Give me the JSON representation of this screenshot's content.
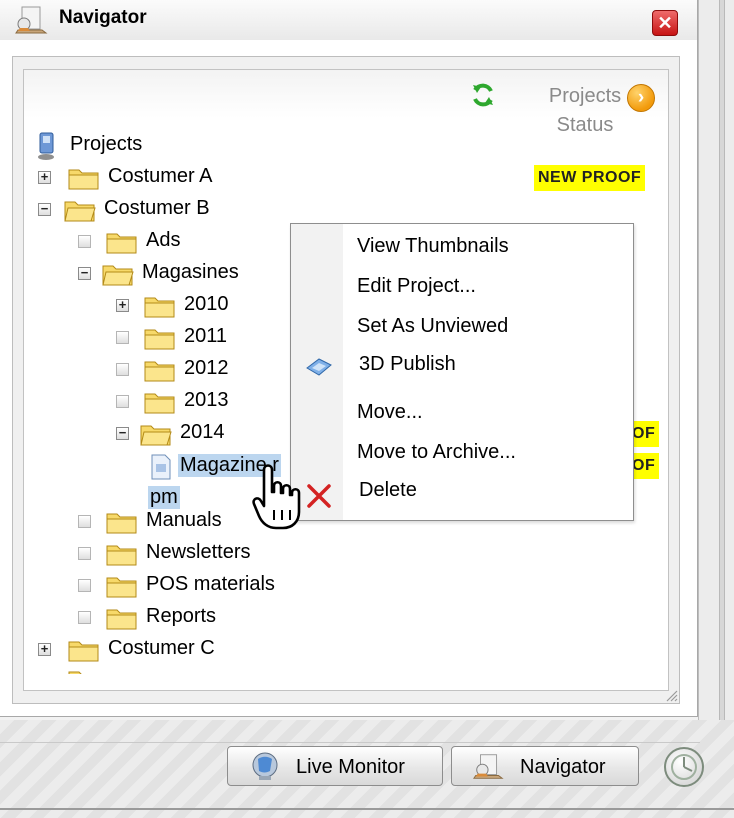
{
  "window": {
    "title": "Navigator",
    "close_label": "✕"
  },
  "header": {
    "projects_status_line1": "Projects",
    "projects_status_line2": "Status",
    "arrow_glyph": "›"
  },
  "tree": {
    "root": "Projects",
    "costumer_a": "Costumer A",
    "costumer_b": "Costumer B",
    "ads": "Ads",
    "magasines": "Magasines",
    "y2010": "2010",
    "y2011": "2011",
    "y2012": "2012",
    "y2013": "2013",
    "y2014": "2014",
    "magazine_file_line1": "Magazine r",
    "magazine_file_line2": "pm",
    "manuals": "Manuals",
    "newsletters": "Newsletters",
    "pos_materials": "POS materials",
    "reports": "Reports",
    "costumer_c": "Costumer C"
  },
  "badges": {
    "new_proof": "NEW PROOF",
    "partial_1": "OF",
    "partial_2": "OF"
  },
  "context_menu": {
    "items": [
      {
        "label": "View Thumbnails"
      },
      {
        "label": "Edit Project..."
      },
      {
        "label": "Set As Unviewed"
      },
      {
        "label": "3D Publish",
        "icon": "3d-publish-icon"
      },
      {
        "label": "Move..."
      },
      {
        "label": "Move to Archive..."
      },
      {
        "label": "Delete",
        "icon": "delete-x-icon"
      }
    ]
  },
  "taskbar": {
    "live_monitor": "Live Monitor",
    "navigator": "Navigator"
  },
  "colors": {
    "badge": "#ffff00",
    "selection": "#bcd6ef",
    "close": "#d42020",
    "status_arrow": "#f29a0b"
  }
}
